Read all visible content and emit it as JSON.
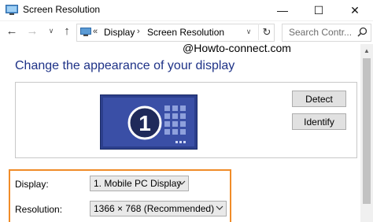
{
  "window": {
    "title": "Screen Resolution",
    "minimize_glyph": "—",
    "maximize_glyph": "☐",
    "close_glyph": "✕"
  },
  "nav": {
    "back_glyph": "←",
    "forward_glyph": "→",
    "recent_glyph": "∨",
    "up_glyph": "↑",
    "address": {
      "overflow_glyph": "«",
      "crumbs": [
        "Display",
        "Screen Resolution"
      ],
      "separator_glyph": "›",
      "dropdown_glyph": "∨",
      "refresh_glyph": "↻"
    },
    "search_placeholder": "Search Contr..."
  },
  "watermark": "@Howto-connect.com",
  "main": {
    "heading": "Change the appearance of your display",
    "monitor_number": "1",
    "detect_label": "Detect",
    "identify_label": "Identify",
    "display_label": "Display:",
    "display_value": "1. Mobile PC Display",
    "resolution_label": "Resolution:",
    "resolution_value": "1366 × 768 (Recommended)"
  },
  "colors": {
    "heading": "#1e3287",
    "highlight_border": "#f08c28",
    "monitor_screen": "#3a4fa6"
  },
  "icons": [
    "control-panel-icon",
    "search-icon",
    "chevron-down-icon",
    "monitor-icon"
  ]
}
